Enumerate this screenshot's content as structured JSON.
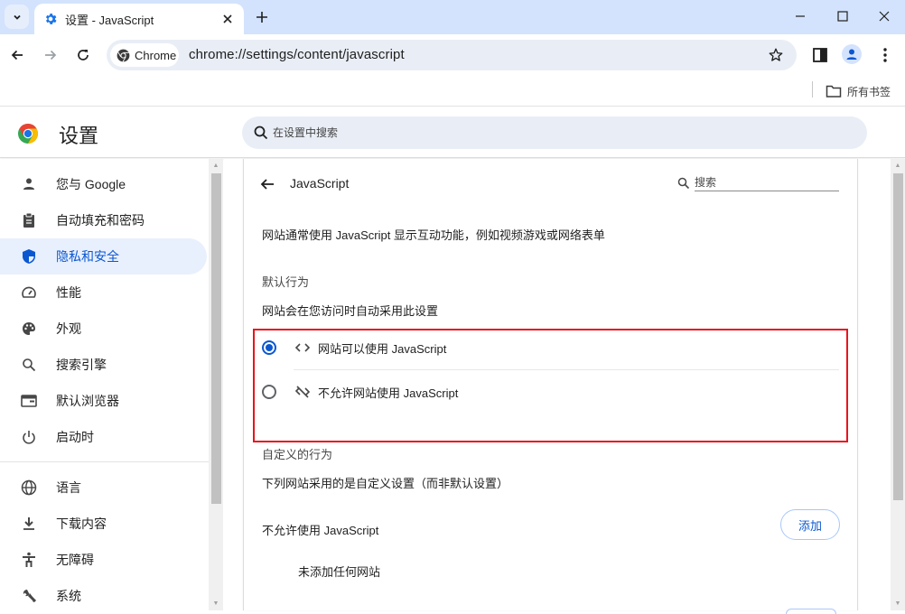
{
  "browser": {
    "tab_title": "设置 - JavaScript",
    "omnibox_chip": "Chrome",
    "url": "chrome://settings/content/javascript",
    "bookmarks_all": "所有书签"
  },
  "settings": {
    "title": "设置",
    "search_placeholder": "在设置中搜索"
  },
  "sidebar": {
    "items": [
      {
        "label": "您与 Google",
        "icon": "person-icon",
        "active": false
      },
      {
        "label": "自动填充和密码",
        "icon": "clipboard-icon",
        "active": false
      },
      {
        "label": "隐私和安全",
        "icon": "shield-icon",
        "active": true
      },
      {
        "label": "性能",
        "icon": "speedometer-icon",
        "active": false
      },
      {
        "label": "外观",
        "icon": "palette-icon",
        "active": false
      },
      {
        "label": "搜索引擎",
        "icon": "search-icon",
        "active": false
      },
      {
        "label": "默认浏览器",
        "icon": "browser-window-icon",
        "active": false
      },
      {
        "label": "启动时",
        "icon": "power-icon",
        "active": false
      },
      {
        "label": "语言",
        "icon": "globe-icon",
        "active": false
      },
      {
        "label": "下载内容",
        "icon": "download-icon",
        "active": false
      },
      {
        "label": "无障碍",
        "icon": "accessibility-icon",
        "active": false
      },
      {
        "label": "系统",
        "icon": "wrench-icon",
        "active": false
      }
    ]
  },
  "page": {
    "heading": "JavaScript",
    "search_placeholder": "搜索",
    "description": "网站通常使用 JavaScript 显示互动功能，例如视频游戏或网络表单",
    "default_behavior": {
      "title": "默认行为",
      "subtitle": "网站会在您访问时自动采用此设置",
      "options": [
        {
          "label": "网站可以使用 JavaScript",
          "icon": "code-icon",
          "checked": true
        },
        {
          "label": "不允许网站使用 JavaScript",
          "icon": "code-off-icon",
          "checked": false
        }
      ]
    },
    "custom_behavior": {
      "title": "自定义的行为",
      "subtitle": "下列网站采用的是自定义设置（而非默认设置）",
      "blocked_title": "不允许使用 JavaScript",
      "add_label": "添加",
      "empty_text": "未添加任何网站"
    }
  },
  "colors": {
    "accent": "#0b57d0",
    "highlight_box": "#e8141c",
    "titlebar": "#d3e3fd"
  }
}
